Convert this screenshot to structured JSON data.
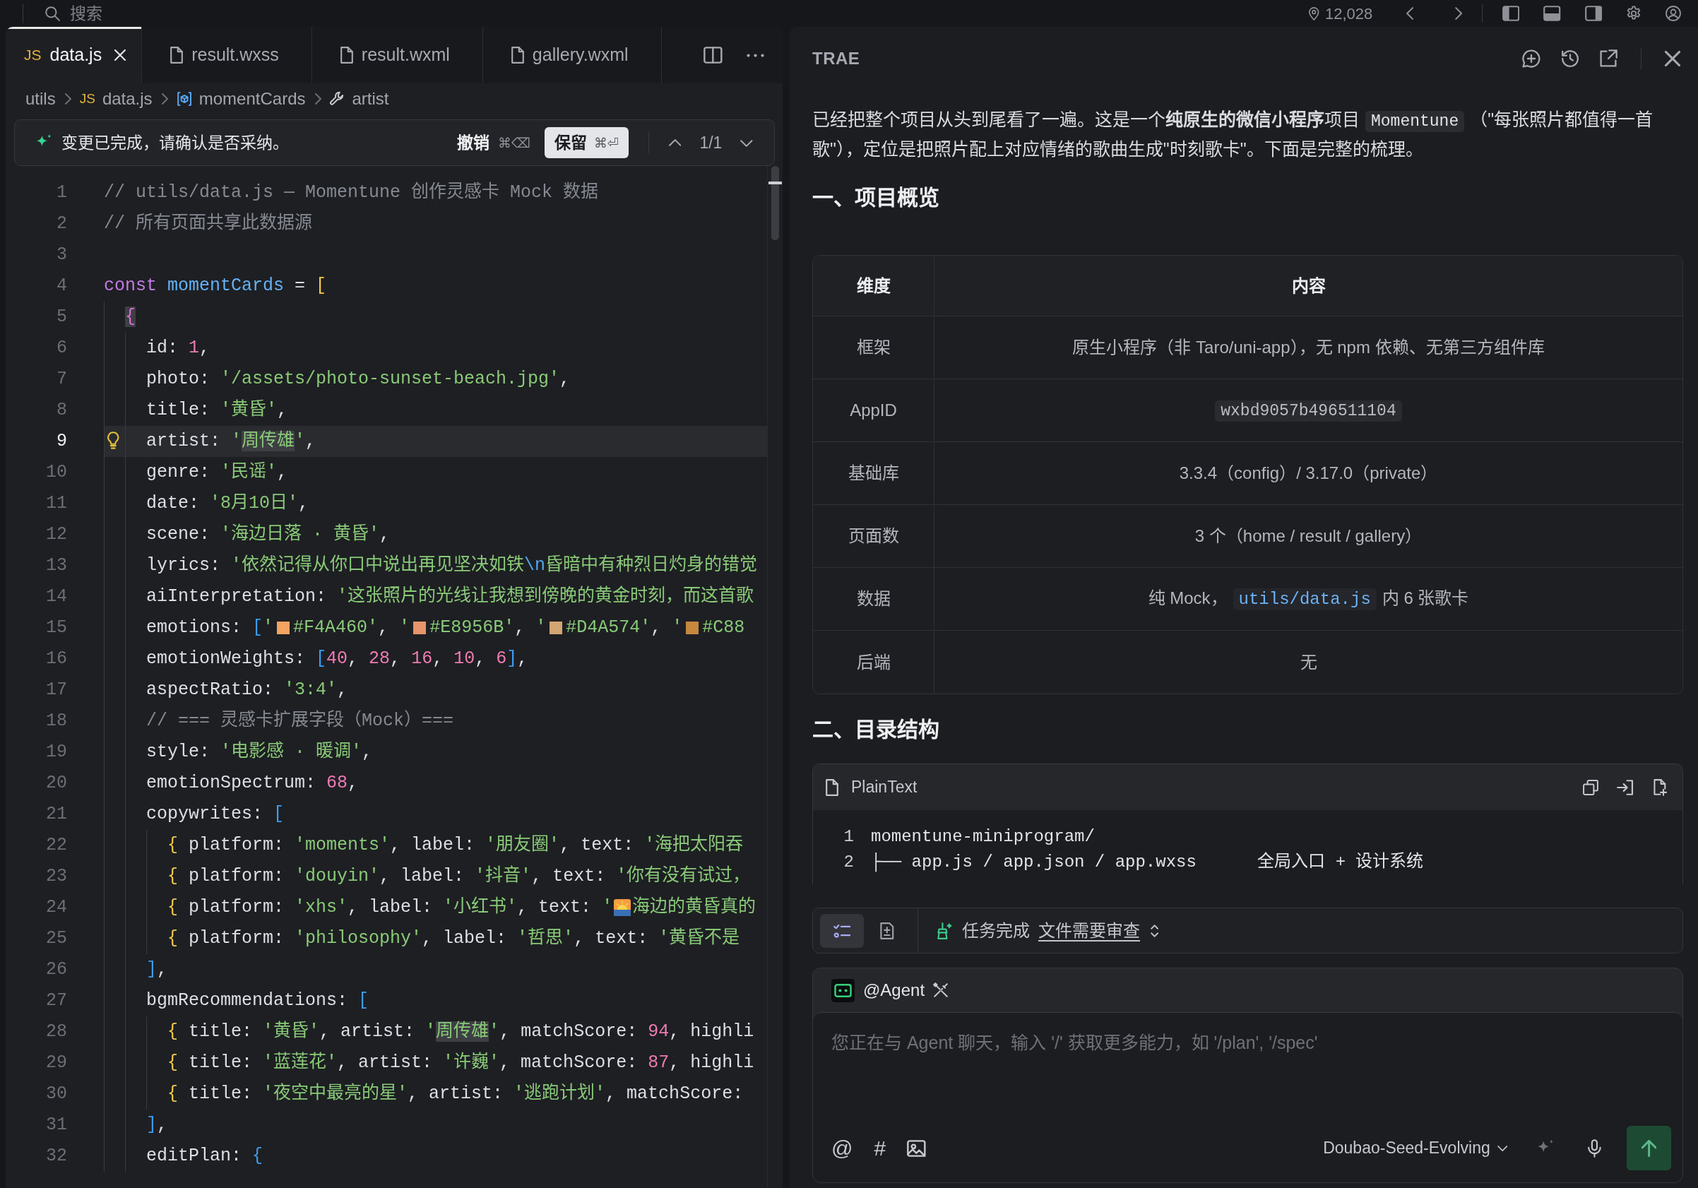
{
  "top_bar": {
    "search": {
      "placeholder": "搜索"
    },
    "count": "12,028"
  },
  "editor": {
    "tabs": [
      {
        "label": "data.js",
        "kind": "js",
        "type_label": "JS",
        "selected": true
      },
      {
        "label": "result.wxss",
        "kind": "file",
        "selected": false
      },
      {
        "label": "result.wxml",
        "kind": "file",
        "selected": false
      },
      {
        "label": "gallery.wxml",
        "kind": "file",
        "selected": false
      }
    ],
    "breadcrumb": [
      {
        "label": "utils",
        "kind": "folder"
      },
      {
        "label": "data.js",
        "kind": "js",
        "type_label": "JS"
      },
      {
        "label": "momentCards",
        "kind": "variable"
      },
      {
        "label": "artist",
        "kind": "property"
      }
    ],
    "change_bar": {
      "message": "变更已完成，请确认是否采纳。",
      "undo": {
        "label": "撤销",
        "shortcut": "⌘⌫"
      },
      "keep": {
        "label": "保留",
        "shortcut": "⌘⏎"
      },
      "counter": "1/1"
    },
    "lines": [
      {
        "number": "1",
        "current": false,
        "parts": [
          {
            "kind": "comment",
            "text": "// utils/data.js — Momentune 创作灵感卡 Mock 数据"
          }
        ]
      },
      {
        "number": "2",
        "current": false,
        "parts": [
          {
            "kind": "comment",
            "text": "// 所有页面共享此数据源"
          }
        ]
      },
      {
        "number": "3",
        "current": false
      },
      {
        "number": "4",
        "current": false,
        "parts": [
          {
            "kind": "keyword",
            "text": "const"
          },
          {
            "kind": "variable",
            "text": " momentCards"
          },
          {
            "kind": "plain",
            "text": " = "
          },
          {
            "kind": "bracket1",
            "text": "["
          }
        ]
      },
      {
        "number": "5",
        "current": false,
        "parts": [
          {
            "kind": "matched_bracket",
            "text": "  {"
          }
        ]
      },
      {
        "number": "6",
        "current": false,
        "parts": [
          {
            "kind": "plain",
            "text": "    id: "
          },
          {
            "kind": "number",
            "text": "1"
          },
          {
            "kind": "plain",
            "text": ","
          }
        ]
      },
      {
        "number": "7",
        "current": false,
        "parts": [
          {
            "kind": "plain",
            "text": "    photo: "
          },
          {
            "kind": "string",
            "text": "'/assets/photo-sunset-beach.jpg'"
          },
          {
            "kind": "plain",
            "text": ","
          }
        ]
      },
      {
        "number": "8",
        "current": false,
        "parts": [
          {
            "kind": "plain",
            "text": "    title: "
          },
          {
            "kind": "string",
            "text": "'黄昏'"
          },
          {
            "kind": "plain",
            "text": ","
          }
        ]
      },
      {
        "number": "9",
        "current": true,
        "parts": [
          {
            "kind": "plain",
            "text": "    artist: "
          },
          {
            "kind": "string",
            "text": "'"
          },
          {
            "kind": "match",
            "text": "周传雄"
          },
          {
            "kind": "string",
            "text": "'"
          },
          {
            "kind": "plain",
            "text": ","
          }
        ]
      },
      {
        "number": "10",
        "current": false,
        "parts": [
          {
            "kind": "plain",
            "text": "    genre: "
          },
          {
            "kind": "string",
            "text": "'民谣'"
          },
          {
            "kind": "plain",
            "text": ","
          }
        ]
      },
      {
        "number": "11",
        "current": false,
        "parts": [
          {
            "kind": "plain",
            "text": "    date: "
          },
          {
            "kind": "string",
            "text": "'8月10日'"
          },
          {
            "kind": "plain",
            "text": ","
          }
        ]
      },
      {
        "number": "12",
        "current": false,
        "parts": [
          {
            "kind": "plain",
            "text": "    scene: "
          },
          {
            "kind": "string",
            "text": "'海边日落 · 黄昏'"
          },
          {
            "kind": "plain",
            "text": ","
          }
        ]
      },
      {
        "number": "13",
        "current": false,
        "parts": [
          {
            "kind": "plain",
            "text": "    lyrics: "
          },
          {
            "kind": "string",
            "text": "'依然记得从你口中说出再见坚决如铁"
          },
          {
            "kind": "escape",
            "text": "\\n"
          },
          {
            "kind": "string",
            "text": "昏暗中有种烈日灼身的错觉"
          }
        ]
      },
      {
        "number": "14",
        "current": false,
        "parts": [
          {
            "kind": "plain",
            "text": "    aiInterpretation: "
          },
          {
            "kind": "string",
            "text": "'这张照片的光线让我想到傍晚的黄金时刻，而这首歌"
          }
        ]
      },
      {
        "number": "15",
        "current": false,
        "parts": [
          {
            "kind": "plain",
            "text": "    emotions: "
          },
          {
            "kind": "bracket3",
            "text": "["
          },
          {
            "kind": "string",
            "text": "'"
          },
          {
            "kind": "swatch",
            "color": "#F4A460"
          },
          {
            "kind": "string",
            "text": "#F4A460'"
          },
          {
            "kind": "plain",
            "text": ", "
          },
          {
            "kind": "string",
            "text": "'"
          },
          {
            "kind": "swatch",
            "color": "#E8956B"
          },
          {
            "kind": "string",
            "text": "#E8956B'"
          },
          {
            "kind": "plain",
            "text": ", "
          },
          {
            "kind": "string",
            "text": "'"
          },
          {
            "kind": "swatch",
            "color": "#D4A574"
          },
          {
            "kind": "string",
            "text": "#D4A574'"
          },
          {
            "kind": "plain",
            "text": ", "
          },
          {
            "kind": "string",
            "text": "'"
          },
          {
            "kind": "swatch",
            "color": "#C8873F"
          },
          {
            "kind": "string",
            "text": "#C88"
          }
        ]
      },
      {
        "number": "16",
        "current": false,
        "parts": [
          {
            "kind": "plain",
            "text": "    emotionWeights: "
          },
          {
            "kind": "bracket3",
            "text": "["
          },
          {
            "kind": "number",
            "text": "40"
          },
          {
            "kind": "plain",
            "text": ", "
          },
          {
            "kind": "number",
            "text": "28"
          },
          {
            "kind": "plain",
            "text": ", "
          },
          {
            "kind": "number",
            "text": "16"
          },
          {
            "kind": "plain",
            "text": ", "
          },
          {
            "kind": "number",
            "text": "10"
          },
          {
            "kind": "plain",
            "text": ", "
          },
          {
            "kind": "number",
            "text": "6"
          },
          {
            "kind": "bracket3",
            "text": "]"
          },
          {
            "kind": "plain",
            "text": ","
          }
        ]
      },
      {
        "number": "17",
        "current": false,
        "parts": [
          {
            "kind": "plain",
            "text": "    aspectRatio: "
          },
          {
            "kind": "string",
            "text": "'3:4'"
          },
          {
            "kind": "plain",
            "text": ","
          }
        ]
      },
      {
        "number": "18",
        "current": false,
        "parts": [
          {
            "kind": "comment",
            "text": "    // === 灵感卡扩展字段（Mock）==="
          }
        ]
      },
      {
        "number": "19",
        "current": false,
        "parts": [
          {
            "kind": "plain",
            "text": "    style: "
          },
          {
            "kind": "string",
            "text": "'电影感 · 暖调'"
          },
          {
            "kind": "plain",
            "text": ","
          }
        ]
      },
      {
        "number": "20",
        "current": false,
        "parts": [
          {
            "kind": "plain",
            "text": "    emotionSpectrum: "
          },
          {
            "kind": "number",
            "text": "68"
          },
          {
            "kind": "plain",
            "text": ","
          }
        ]
      },
      {
        "number": "21",
        "current": false,
        "parts": [
          {
            "kind": "plain",
            "text": "    copywrites: "
          },
          {
            "kind": "bracket3",
            "text": "["
          }
        ]
      },
      {
        "number": "22",
        "current": false,
        "parts": [
          {
            "kind": "bracket1",
            "text": "      {"
          },
          {
            "kind": "plain",
            "text": " platform: "
          },
          {
            "kind": "string",
            "text": "'moments'"
          },
          {
            "kind": "plain",
            "text": ", label: "
          },
          {
            "kind": "string",
            "text": "'朋友圈'"
          },
          {
            "kind": "plain",
            "text": ", text: "
          },
          {
            "kind": "string",
            "text": "'海把太阳吞"
          }
        ]
      },
      {
        "number": "23",
        "current": false,
        "parts": [
          {
            "kind": "bracket1",
            "text": "      {"
          },
          {
            "kind": "plain",
            "text": " platform: "
          },
          {
            "kind": "string",
            "text": "'douyin'"
          },
          {
            "kind": "plain",
            "text": ", label: "
          },
          {
            "kind": "string",
            "text": "'抖音'"
          },
          {
            "kind": "plain",
            "text": ", text: "
          },
          {
            "kind": "string",
            "text": "'你有没有试过，"
          }
        ]
      },
      {
        "number": "24",
        "current": false,
        "parts": [
          {
            "kind": "bracket1",
            "text": "      {"
          },
          {
            "kind": "plain",
            "text": " platform: "
          },
          {
            "kind": "string",
            "text": "'xhs'"
          },
          {
            "kind": "plain",
            "text": ", label: "
          },
          {
            "kind": "string",
            "text": "'小红书'"
          },
          {
            "kind": "plain",
            "text": ", text: "
          },
          {
            "kind": "string",
            "text": "'"
          },
          {
            "kind": "emoji"
          },
          {
            "kind": "string",
            "text": "海边的黄昏真的"
          }
        ]
      },
      {
        "number": "25",
        "current": false,
        "parts": [
          {
            "kind": "bracket1",
            "text": "      {"
          },
          {
            "kind": "plain",
            "text": " platform: "
          },
          {
            "kind": "string",
            "text": "'philosophy'"
          },
          {
            "kind": "plain",
            "text": ", label: "
          },
          {
            "kind": "string",
            "text": "'哲思'"
          },
          {
            "kind": "plain",
            "text": ", text: "
          },
          {
            "kind": "string",
            "text": "'黄昏不是"
          }
        ]
      },
      {
        "number": "26",
        "current": false,
        "parts": [
          {
            "kind": "bracket3",
            "text": "    ]"
          },
          {
            "kind": "plain",
            "text": ","
          }
        ]
      },
      {
        "number": "27",
        "current": false,
        "parts": [
          {
            "kind": "plain",
            "text": "    bgmRecommendations: "
          },
          {
            "kind": "bracket3",
            "text": "["
          }
        ]
      },
      {
        "number": "28",
        "current": false,
        "parts": [
          {
            "kind": "bracket1",
            "text": "      {"
          },
          {
            "kind": "plain",
            "text": " title: "
          },
          {
            "kind": "string",
            "text": "'黄昏'"
          },
          {
            "kind": "plain",
            "text": ", artist: "
          },
          {
            "kind": "string",
            "text": "'"
          },
          {
            "kind": "match",
            "text": "周传雄"
          },
          {
            "kind": "string",
            "text": "'"
          },
          {
            "kind": "plain",
            "text": ", matchScore: "
          },
          {
            "kind": "number",
            "text": "94"
          },
          {
            "kind": "plain",
            "text": ", highli"
          }
        ]
      },
      {
        "number": "29",
        "current": false,
        "parts": [
          {
            "kind": "bracket1",
            "text": "      {"
          },
          {
            "kind": "plain",
            "text": " title: "
          },
          {
            "kind": "string",
            "text": "'蓝莲花'"
          },
          {
            "kind": "plain",
            "text": ", artist: "
          },
          {
            "kind": "string",
            "text": "'许巍'"
          },
          {
            "kind": "plain",
            "text": ", matchScore: "
          },
          {
            "kind": "number",
            "text": "87"
          },
          {
            "kind": "plain",
            "text": ", highli"
          }
        ]
      },
      {
        "number": "30",
        "current": false,
        "parts": [
          {
            "kind": "bracket1",
            "text": "      {"
          },
          {
            "kind": "plain",
            "text": " title: "
          },
          {
            "kind": "string",
            "text": "'夜空中最亮的星'"
          },
          {
            "kind": "plain",
            "text": ", artist: "
          },
          {
            "kind": "string",
            "text": "'逃跑计划'"
          },
          {
            "kind": "plain",
            "text": ", matchScore:"
          }
        ]
      },
      {
        "number": "31",
        "current": false,
        "parts": [
          {
            "kind": "bracket3",
            "text": "    ]"
          },
          {
            "kind": "plain",
            "text": ","
          }
        ]
      },
      {
        "number": "32",
        "current": false,
        "parts": [
          {
            "kind": "plain",
            "text": "    editPlan: "
          },
          {
            "kind": "bracket3",
            "text": "{"
          }
        ]
      }
    ]
  },
  "assistant": {
    "title": "TRAE",
    "message": [
      {
        "kind": "text",
        "text": "已经把整个项目从头到尾看了一遍。这是一个**纯原生的微信小程序**项目"
      },
      {
        "kind": "code",
        "text": "Momentune"
      },
      {
        "kind": "text",
        "text": "（\"每张照片都值得一首歌\"），定位是把照片配上对应情绪的歌曲生成\"时刻歌卡\"。下面是完整的梳理。"
      }
    ],
    "overview": {
      "heading": "一、项目概览",
      "columns": [
        "维度",
        "内容"
      ],
      "rows": [
        {
          "label": "框架",
          "content": [
            {
              "kind": "text",
              "text": "原生小程序（非 Taro/uni-app），无 npm 依赖、无第三方组件库"
            }
          ]
        },
        {
          "label": "AppID",
          "content": [
            {
              "kind": "code",
              "text": "wxbd9057b496511104"
            }
          ]
        },
        {
          "label": "基础库",
          "content": [
            {
              "kind": "text",
              "text": "3.3.4（config）/ 3.17.0（private）"
            }
          ]
        },
        {
          "label": "页面数",
          "content": [
            {
              "kind": "text",
              "text": "3 个（home / result / gallery）"
            }
          ]
        },
        {
          "label": "数据",
          "content": [
            {
              "kind": "text",
              "text": "纯 Mock，"
            },
            {
              "kind": "file",
              "text": "utils/data.js"
            },
            {
              "kind": "text",
              "text": "内 6 张歌卡"
            }
          ]
        },
        {
          "label": "后端",
          "content": [
            {
              "kind": "text",
              "text": "无"
            }
          ]
        }
      ]
    },
    "structure": {
      "heading": "二、目录结构",
      "language": "PlainText",
      "lines": [
        {
          "number": "1",
          "text": "momentune-miniprogram/"
        },
        {
          "number": "2",
          "text": "├── app.js / app.json / app.wxss      全局入口 + 设计系统"
        }
      ]
    },
    "task_bar": {
      "views": [
        {
          "kind": "checklist",
          "selected": true
        },
        {
          "kind": "files",
          "selected": false
        }
      ],
      "status": "任务完成",
      "link": "文件需要审查"
    },
    "composer": {
      "agent": "@Agent",
      "placeholder": "您正在与 Agent 聊天，输入 '/' 获取更多能力，如 '/plan', '/spec'",
      "tools": [
        {
          "kind": "mention",
          "label": "@"
        },
        {
          "kind": "tag",
          "label": "#"
        },
        {
          "kind": "image"
        }
      ],
      "model": "Doubao-Seed-Evolving"
    }
  }
}
